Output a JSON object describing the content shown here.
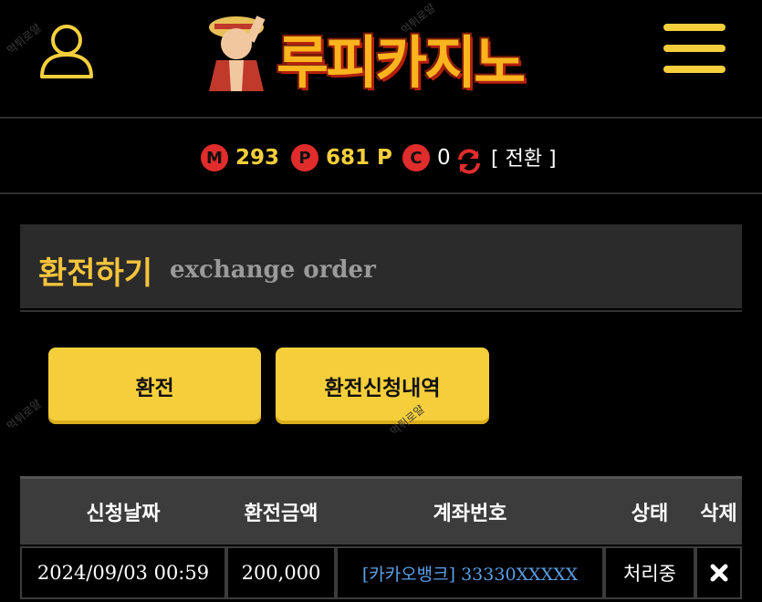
{
  "header": {
    "logo_text": "루피카지노",
    "watermark": "먹튀로얄"
  },
  "balance": {
    "money_badge": "M",
    "money": "293",
    "point_badge": "P",
    "point": "681 P",
    "coin_badge": "C",
    "coin": "0",
    "convert_label": "[ 전환 ]"
  },
  "panel": {
    "title": "환전하기",
    "subtitle": "exchange order"
  },
  "buttons": {
    "exchange": "환전",
    "history": "환전신청내역"
  },
  "table": {
    "headers": [
      "신청날짜",
      "환전금액",
      "계좌번호",
      "상태",
      "삭제"
    ],
    "rows": [
      {
        "date": "2024/09/03 00:59",
        "amount": "200,000",
        "account": "[카카오뱅크] 33330XXXXX",
        "status": "처리중"
      }
    ]
  },
  "colors": {
    "accent": "#f5cf3b",
    "badge": "#e12c2c",
    "link": "#5aa0e6"
  }
}
